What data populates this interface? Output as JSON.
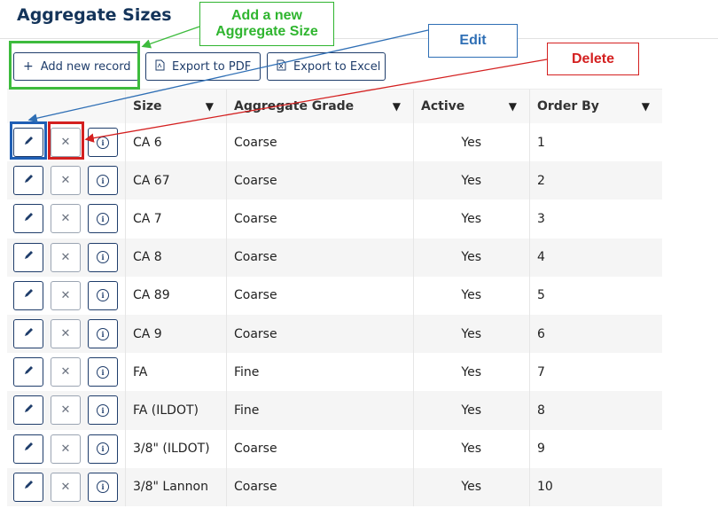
{
  "page": {
    "title": "Aggregate Sizes"
  },
  "toolbar": {
    "add_label": "Add new record",
    "pdf_label": "Export to PDF",
    "excel_label": "Export to Excel"
  },
  "columns": [
    "Size",
    "Aggregate Grade",
    "Active",
    "Order By"
  ],
  "rows": [
    {
      "size": "CA 6",
      "grade": "Coarse",
      "active": "Yes",
      "order": "1"
    },
    {
      "size": "CA 67",
      "grade": "Coarse",
      "active": "Yes",
      "order": "2"
    },
    {
      "size": "CA 7",
      "grade": "Coarse",
      "active": "Yes",
      "order": "3"
    },
    {
      "size": "CA 8",
      "grade": "Coarse",
      "active": "Yes",
      "order": "4"
    },
    {
      "size": "CA 89",
      "grade": "Coarse",
      "active": "Yes",
      "order": "5"
    },
    {
      "size": "CA 9",
      "grade": "Coarse",
      "active": "Yes",
      "order": "6"
    },
    {
      "size": "FA",
      "grade": "Fine",
      "active": "Yes",
      "order": "7"
    },
    {
      "size": "FA (ILDOT)",
      "grade": "Fine",
      "active": "Yes",
      "order": "8"
    },
    {
      "size": "3/8\" (ILDOT)",
      "grade": "Coarse",
      "active": "Yes",
      "order": "9"
    },
    {
      "size": "3/8\" Lannon",
      "grade": "Coarse",
      "active": "Yes",
      "order": "10"
    }
  ],
  "annotations": {
    "add_line1": "Add a new",
    "add_line2": "Aggregate Size",
    "edit": "Edit",
    "delete": "Delete"
  },
  "icons": {
    "add": "plus-icon",
    "pdf": "pdf-file-icon",
    "excel": "excel-file-icon",
    "filter": "filter-icon",
    "edit": "pencil-icon",
    "delete": "close-icon",
    "info": "info-icon"
  },
  "colors": {
    "title": "#14345a",
    "button_border": "#1f3d6b",
    "annotation_green": "#3dbb3d",
    "annotation_blue": "#2f6fb5",
    "annotation_red": "#d42020"
  }
}
